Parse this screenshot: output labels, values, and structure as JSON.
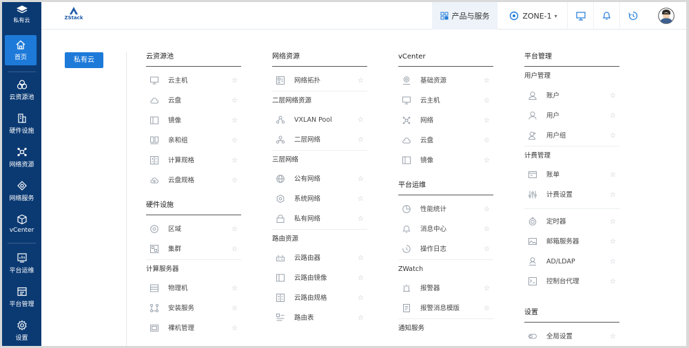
{
  "sidebar": {
    "brand_label": "私有云",
    "items": [
      {
        "label": "首页",
        "icon": "home-icon"
      },
      {
        "label": "云资源池",
        "icon": "cloud-pool-icon"
      },
      {
        "label": "硬件设施",
        "icon": "hardware-icon"
      },
      {
        "label": "网络资源",
        "icon": "network-resource-icon"
      },
      {
        "label": "网络服务",
        "icon": "network-service-icon"
      },
      {
        "label": "vCenter",
        "icon": "vcenter-icon"
      },
      {
        "label": "平台运维",
        "icon": "ops-icon"
      },
      {
        "label": "平台管理",
        "icon": "platform-admin-icon"
      },
      {
        "label": "设置",
        "icon": "settings-icon"
      }
    ]
  },
  "header": {
    "logo_text": "ZStack",
    "products_label": "产品与服务",
    "zone_label": "ZONE-1"
  },
  "private_cloud_button": "私有云",
  "col1": {
    "title": "云资源池",
    "items": [
      "云主机",
      "云盘",
      "镜像",
      "亲和组",
      "计算规格",
      "云盘规格"
    ],
    "hw_title": "硬件设施",
    "hw_items": [
      "区域",
      "集群"
    ],
    "compute_title": "计算服务器",
    "compute_items": [
      "物理机",
      "安装服务",
      "裸机管理"
    ]
  },
  "col2": {
    "title": "网络资源",
    "items": [
      "网络拓扑"
    ],
    "l2_title": "二层网络资源",
    "l2_items": [
      "VXLAN Pool",
      "二层网络"
    ],
    "l3_title": "三层网络",
    "l3_items": [
      "公有网络",
      "系统网络",
      "私有网络"
    ],
    "route_title": "路由资源",
    "route_items": [
      "云路由器",
      "云路由镜像",
      "云路由规格",
      "路由表"
    ]
  },
  "col3": {
    "title": "vCenter",
    "items": [
      "基础资源",
      "云主机",
      "网络",
      "云盘",
      "镜像"
    ],
    "ops_title": "平台运维",
    "ops_items": [
      "性能统计",
      "消息中心",
      "操作日志"
    ],
    "zwatch_title": "ZWatch",
    "zwatch_items": [
      "报警器",
      "报警消息模版"
    ],
    "notify_title": "通知服务"
  },
  "col4": {
    "title": "平台管理",
    "user_title": "用户管理",
    "user_items": [
      "账户",
      "用户",
      "用户组"
    ],
    "bill_title": "计费管理",
    "bill_items": [
      "账单",
      "计费设置"
    ],
    "other_items": [
      "定时器",
      "邮箱服务器",
      "AD/LDAP",
      "控制台代理"
    ],
    "settings_title": "设置",
    "settings_items": [
      "全局设置"
    ]
  },
  "star_glyph": "☆",
  "colors": {
    "sidebar": "#0b3a73",
    "accent": "#1e7ad9"
  }
}
